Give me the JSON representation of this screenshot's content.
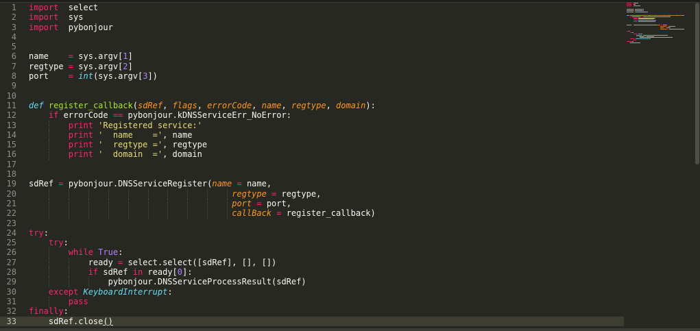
{
  "editor": {
    "current_line": 33,
    "lines": [
      {
        "n": "1",
        "tokens": [
          [
            "t-kw",
            "import"
          ],
          [
            "",
            "  select"
          ]
        ]
      },
      {
        "n": "2",
        "tokens": [
          [
            "t-kw",
            "import"
          ],
          [
            "",
            "  sys"
          ]
        ]
      },
      {
        "n": "3",
        "tokens": [
          [
            "t-kw",
            "import"
          ],
          [
            "",
            "  pybonjour"
          ]
        ]
      },
      {
        "n": "4",
        "tokens": []
      },
      {
        "n": "5",
        "tokens": []
      },
      {
        "n": "6",
        "tokens": [
          [
            "",
            "name    "
          ],
          [
            "t-op",
            "="
          ],
          [
            "",
            " sys.argv["
          ],
          [
            "t-num",
            "1"
          ],
          [
            "",
            "]"
          ]
        ]
      },
      {
        "n": "7",
        "tokens": [
          [
            "",
            "regtype "
          ],
          [
            "t-op",
            "="
          ],
          [
            "",
            " sys.argv["
          ],
          [
            "t-num",
            "2"
          ],
          [
            "",
            "]"
          ]
        ]
      },
      {
        "n": "8",
        "tokens": [
          [
            "",
            "port    "
          ],
          [
            "t-op",
            "="
          ],
          [
            "",
            " "
          ],
          [
            "t-builtin",
            "int"
          ],
          [
            "",
            "(sys.argv["
          ],
          [
            "t-num",
            "3"
          ],
          [
            "",
            "])"
          ]
        ]
      },
      {
        "n": "9",
        "tokens": []
      },
      {
        "n": "10",
        "tokens": []
      },
      {
        "n": "11",
        "tokens": [
          [
            "t-def",
            "def"
          ],
          [
            "",
            " "
          ],
          [
            "t-fn",
            "register_callback"
          ],
          [
            "",
            "("
          ],
          [
            "t-param",
            "sdRef"
          ],
          [
            "",
            ", "
          ],
          [
            "t-param",
            "flags"
          ],
          [
            "",
            ", "
          ],
          [
            "t-param",
            "errorCode"
          ],
          [
            "",
            ", "
          ],
          [
            "t-param",
            "name"
          ],
          [
            "",
            ", "
          ],
          [
            "t-param",
            "regtype"
          ],
          [
            "",
            ", "
          ],
          [
            "t-param",
            "domain"
          ],
          [
            "",
            "):"
          ]
        ]
      },
      {
        "n": "12",
        "tokens": [
          [
            "",
            "    "
          ],
          [
            "t-kw",
            "if"
          ],
          [
            "",
            " errorCode "
          ],
          [
            "t-op",
            "=="
          ],
          [
            "",
            " pybonjour.kDNSServiceErr_NoError:"
          ]
        ]
      },
      {
        "n": "13",
        "tokens": [
          [
            "",
            "        "
          ],
          [
            "t-kw",
            "print"
          ],
          [
            "",
            " "
          ],
          [
            "t-str",
            "'Registered service:'"
          ]
        ]
      },
      {
        "n": "14",
        "tokens": [
          [
            "",
            "        "
          ],
          [
            "t-kw",
            "print"
          ],
          [
            "",
            " "
          ],
          [
            "t-str",
            "'  name    ='"
          ],
          [
            "",
            ", name"
          ]
        ]
      },
      {
        "n": "15",
        "tokens": [
          [
            "",
            "        "
          ],
          [
            "t-kw",
            "print"
          ],
          [
            "",
            " "
          ],
          [
            "t-str",
            "'  regtype ='"
          ],
          [
            "",
            ", regtype"
          ]
        ]
      },
      {
        "n": "16",
        "tokens": [
          [
            "",
            "        "
          ],
          [
            "t-kw",
            "print"
          ],
          [
            "",
            " "
          ],
          [
            "t-str",
            "'  domain  ='"
          ],
          [
            "",
            ", domain"
          ]
        ]
      },
      {
        "n": "17",
        "tokens": []
      },
      {
        "n": "18",
        "tokens": []
      },
      {
        "n": "19",
        "tokens": [
          [
            "",
            "sdRef "
          ],
          [
            "t-op",
            "="
          ],
          [
            "",
            " pybonjour.DNSServiceRegister("
          ],
          [
            "t-param",
            "name"
          ],
          [
            "",
            " "
          ],
          [
            "t-op",
            "="
          ],
          [
            "",
            " name,"
          ]
        ]
      },
      {
        "n": "20",
        "tokens": [
          [
            "",
            "                                         "
          ],
          [
            "t-param",
            "regtype"
          ],
          [
            "",
            " "
          ],
          [
            "t-op",
            "="
          ],
          [
            "",
            " regtype,"
          ]
        ]
      },
      {
        "n": "21",
        "tokens": [
          [
            "",
            "                                         "
          ],
          [
            "t-param",
            "port"
          ],
          [
            "",
            " "
          ],
          [
            "t-op",
            "="
          ],
          [
            "",
            " port,"
          ]
        ]
      },
      {
        "n": "22",
        "tokens": [
          [
            "",
            "                                         "
          ],
          [
            "t-param",
            "callBack"
          ],
          [
            "",
            " "
          ],
          [
            "t-op",
            "="
          ],
          [
            "",
            " register_callback)"
          ]
        ]
      },
      {
        "n": "23",
        "tokens": []
      },
      {
        "n": "24",
        "tokens": [
          [
            "t-kw",
            "try"
          ],
          [
            "",
            ":"
          ]
        ]
      },
      {
        "n": "25",
        "tokens": [
          [
            "",
            "    "
          ],
          [
            "t-kw",
            "try"
          ],
          [
            "",
            ":"
          ]
        ]
      },
      {
        "n": "26",
        "tokens": [
          [
            "",
            "        "
          ],
          [
            "t-kw",
            "while"
          ],
          [
            "",
            " "
          ],
          [
            "t-const",
            "True"
          ],
          [
            "",
            ":"
          ]
        ]
      },
      {
        "n": "27",
        "tokens": [
          [
            "",
            "            ready "
          ],
          [
            "t-op",
            "="
          ],
          [
            "",
            " select.select([sdRef], [], [])"
          ]
        ]
      },
      {
        "n": "28",
        "tokens": [
          [
            "",
            "            "
          ],
          [
            "t-kw",
            "if"
          ],
          [
            "",
            " sdRef "
          ],
          [
            "t-kw",
            "in"
          ],
          [
            "",
            " ready["
          ],
          [
            "t-num",
            "0"
          ],
          [
            "",
            "]:"
          ]
        ]
      },
      {
        "n": "29",
        "tokens": [
          [
            "",
            "                pybonjour.DNSServiceProcessResult(sdRef)"
          ]
        ]
      },
      {
        "n": "30",
        "tokens": [
          [
            "",
            "    "
          ],
          [
            "t-kw",
            "except"
          ],
          [
            "",
            " "
          ],
          [
            "t-cls",
            "KeyboardInterrupt"
          ],
          [
            "",
            ":"
          ]
        ]
      },
      {
        "n": "31",
        "tokens": [
          [
            "",
            "        "
          ],
          [
            "t-kw",
            "pass"
          ]
        ]
      },
      {
        "n": "32",
        "tokens": [
          [
            "t-kw",
            "finally"
          ],
          [
            "",
            ":"
          ]
        ]
      },
      {
        "n": "33",
        "tokens": [
          [
            "",
            "    sdRef.close"
          ],
          [
            "t-brk",
            "()"
          ]
        ]
      }
    ]
  },
  "colors": {
    "background": "#272822",
    "current_line": "#3e3d32",
    "keyword": "#f92672",
    "function": "#a6e22e",
    "parameter": "#fd971f",
    "number": "#ae81ff",
    "string": "#e6db74",
    "builtin": "#66d9ef"
  },
  "icons": {
    "minimap": "code-minimap",
    "scrollbar": "vertical-scrollbar-thumb"
  }
}
